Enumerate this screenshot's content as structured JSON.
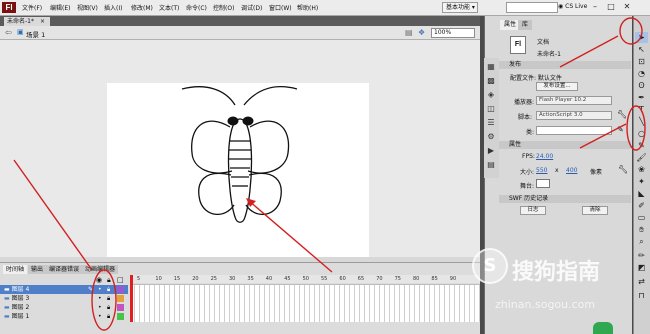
{
  "app": {
    "logo": "Fl"
  },
  "menu": [
    "文件(F)",
    "编辑(E)",
    "视图(V)",
    "插入(I)",
    "修改(M)",
    "文本(T)",
    "命令(C)",
    "控制(O)",
    "调试(D)",
    "窗口(W)",
    "帮助(H)"
  ],
  "workspace": {
    "label": "基本功能 ▾"
  },
  "search": {
    "placeholder": "",
    "cs_live": "◉ CS Live"
  },
  "window_controls": {
    "minimize": "–",
    "maximize": "□",
    "close": "✕"
  },
  "document_tab": {
    "title": "未命名-1*",
    "close": "×"
  },
  "editbar": {
    "scene": "场景 1",
    "zoom": "100%"
  },
  "timeline": {
    "tabs": [
      "时间轴",
      "输出",
      "编译器错误",
      "动画编辑器"
    ],
    "layers": [
      {
        "name": "图层 4",
        "selected": true
      },
      {
        "name": "图层 3",
        "selected": false
      },
      {
        "name": "图层 2",
        "selected": false
      },
      {
        "name": "图层 1",
        "selected": false
      }
    ],
    "layer_colors": [
      "#9b59d0",
      "#e8a13a",
      "#c056c0",
      "#47c447"
    ],
    "frame_numbers": [
      "5",
      "10",
      "15",
      "20",
      "25",
      "30",
      "35",
      "40",
      "45",
      "50",
      "55",
      "60",
      "65",
      "70",
      "75",
      "80",
      "85",
      "90"
    ]
  },
  "panel": {
    "tabs": [
      "属性",
      "库"
    ],
    "doc_icon": "Fl",
    "doc_type": "文档",
    "doc_name": "未命名-1",
    "publish": {
      "header": "发布",
      "profile_label": "配置文件: 默认文件",
      "settings_button": "发布设置...",
      "player_label": "播放器:",
      "player_value": "Flash Player 10.2",
      "script_label": "脚本:",
      "script_value": "ActionScript 3.0",
      "class_label": "类:"
    },
    "properties": {
      "header": "属性",
      "fps_label": "FPS:",
      "fps_value": "24.00",
      "size_label": "大小:",
      "width": "550",
      "x": "x",
      "height": "400",
      "unit": "像素",
      "stage_label": "舞台:"
    },
    "swf": {
      "header": "SWF 历史记录",
      "log_button": "日志",
      "clear_button": "清除"
    }
  },
  "watermark": {
    "logo": "S",
    "text": "搜狗指南",
    "url": "zhinan.sogou.com"
  },
  "colors": {
    "annotation_red": "#d22020",
    "layer_selected": "#4f7fc8"
  }
}
